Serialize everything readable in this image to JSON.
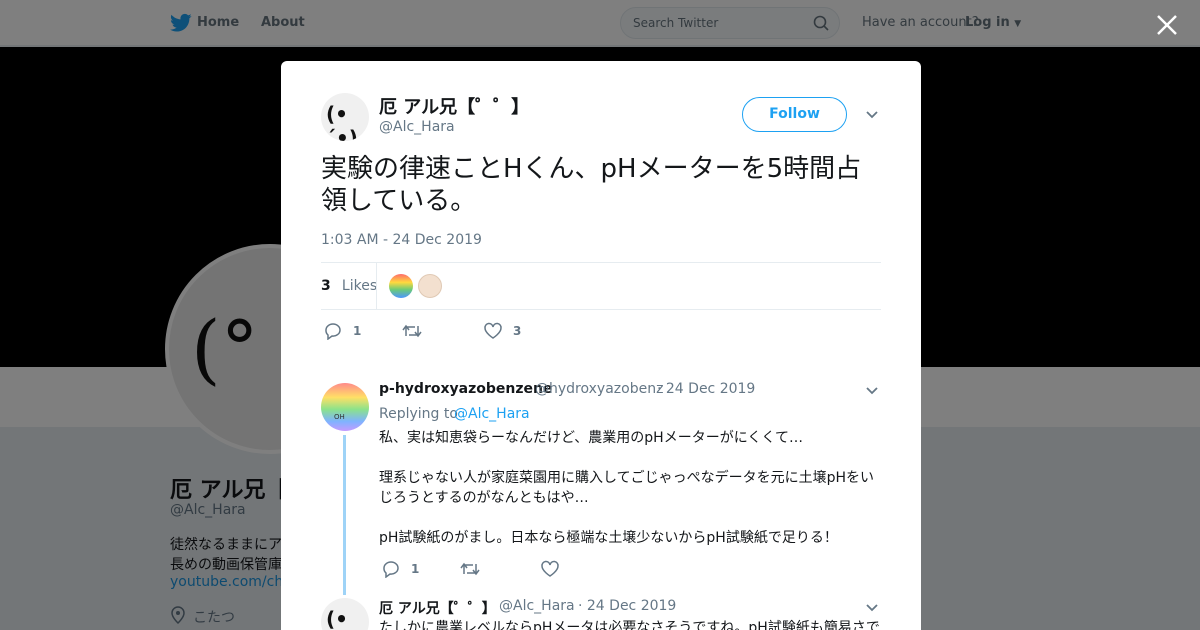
{
  "nav": {
    "home": "Home",
    "about": "About",
    "search_placeholder": "Search Twitter",
    "have_account": "Have an account?",
    "login": "Log in"
  },
  "profile": {
    "name": "厄 アル兄【゜゜】",
    "name_short": "厄 アル兄【",
    "handle": "@Alc_Hara",
    "bio_line1": "徒然なるままにア",
    "bio_line2": "長めの動画保管庫",
    "link": "youtube.com/chan",
    "location": "こたつ",
    "avatar_face": "(°"
  },
  "tweet": {
    "avatar_face": "(•´•)",
    "name": "厄 アル兄【゜゜】",
    "handle": "@Alc_Hara",
    "follow_label": "Follow",
    "text": "実験の律速ことHくん、pHメーターを5時間占領している。",
    "time": "1:03 AM - 24 Dec 2019",
    "likes_count": "3",
    "likes_label": "Likes",
    "reply_count": "1",
    "like_count": "3"
  },
  "replies": [
    {
      "name": "p-hydroxyazobenzene",
      "handle": "@hydroxyazobenz",
      "date": "· 24 Dec 2019",
      "replying_label": "Replying to",
      "replying_to": "@Alc_Hara",
      "line1": "私、実は知恵袋らーなんだけど、農業用のpHメーターがにくくて…",
      "line2": "理系じゃない人が家庭菜園用に購入してごじゃっぺなデータを元に土壌pHをい",
      "line3": "じろうとするのがなんともはや…",
      "line4": "pH試験紙のがまし。日本なら極端な土壌少ないからpH試験紙で足りる！",
      "reply_count": "1",
      "avatar_label": "OH"
    },
    {
      "name": "厄 アル兄【゜゜】",
      "handle": "@Alc_Hara",
      "date": "· 24 Dec 2019",
      "line1": "たしかに農業レベルならpHメータは必要なさそうですね。pH試験紙も簡易さで"
    }
  ]
}
